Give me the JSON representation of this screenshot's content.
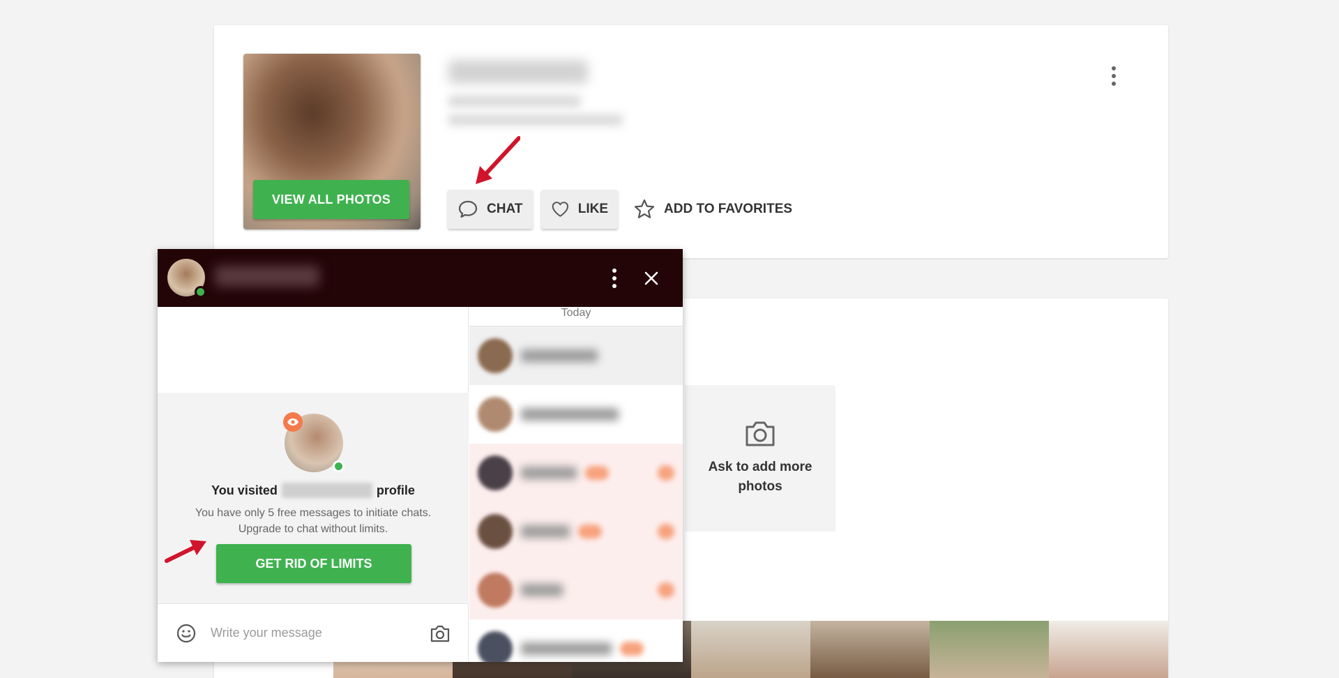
{
  "profile": {
    "view_photos_label": "VIEW ALL PHOTOS",
    "actions": {
      "chat_label": "CHAT",
      "like_label": "LIKE",
      "favorites_label": "ADD TO FAVORITES"
    }
  },
  "gallery": {
    "ask_photos_label": "Ask to add more photos"
  },
  "chat": {
    "date_separator": "Today",
    "visited": {
      "title_prefix": "You visited",
      "title_suffix": "profile",
      "line1": "You have only 5 free messages to initiate chats.",
      "line2": "Upgrade to chat without limits.",
      "button_label": "GET RID OF LIMITS"
    },
    "composer": {
      "placeholder": "Write your message"
    }
  },
  "colors": {
    "accent_green": "#3fb24f",
    "chat_header": "#230407",
    "badge_orange": "#f47a4c",
    "annotation_red": "#d0142b"
  }
}
